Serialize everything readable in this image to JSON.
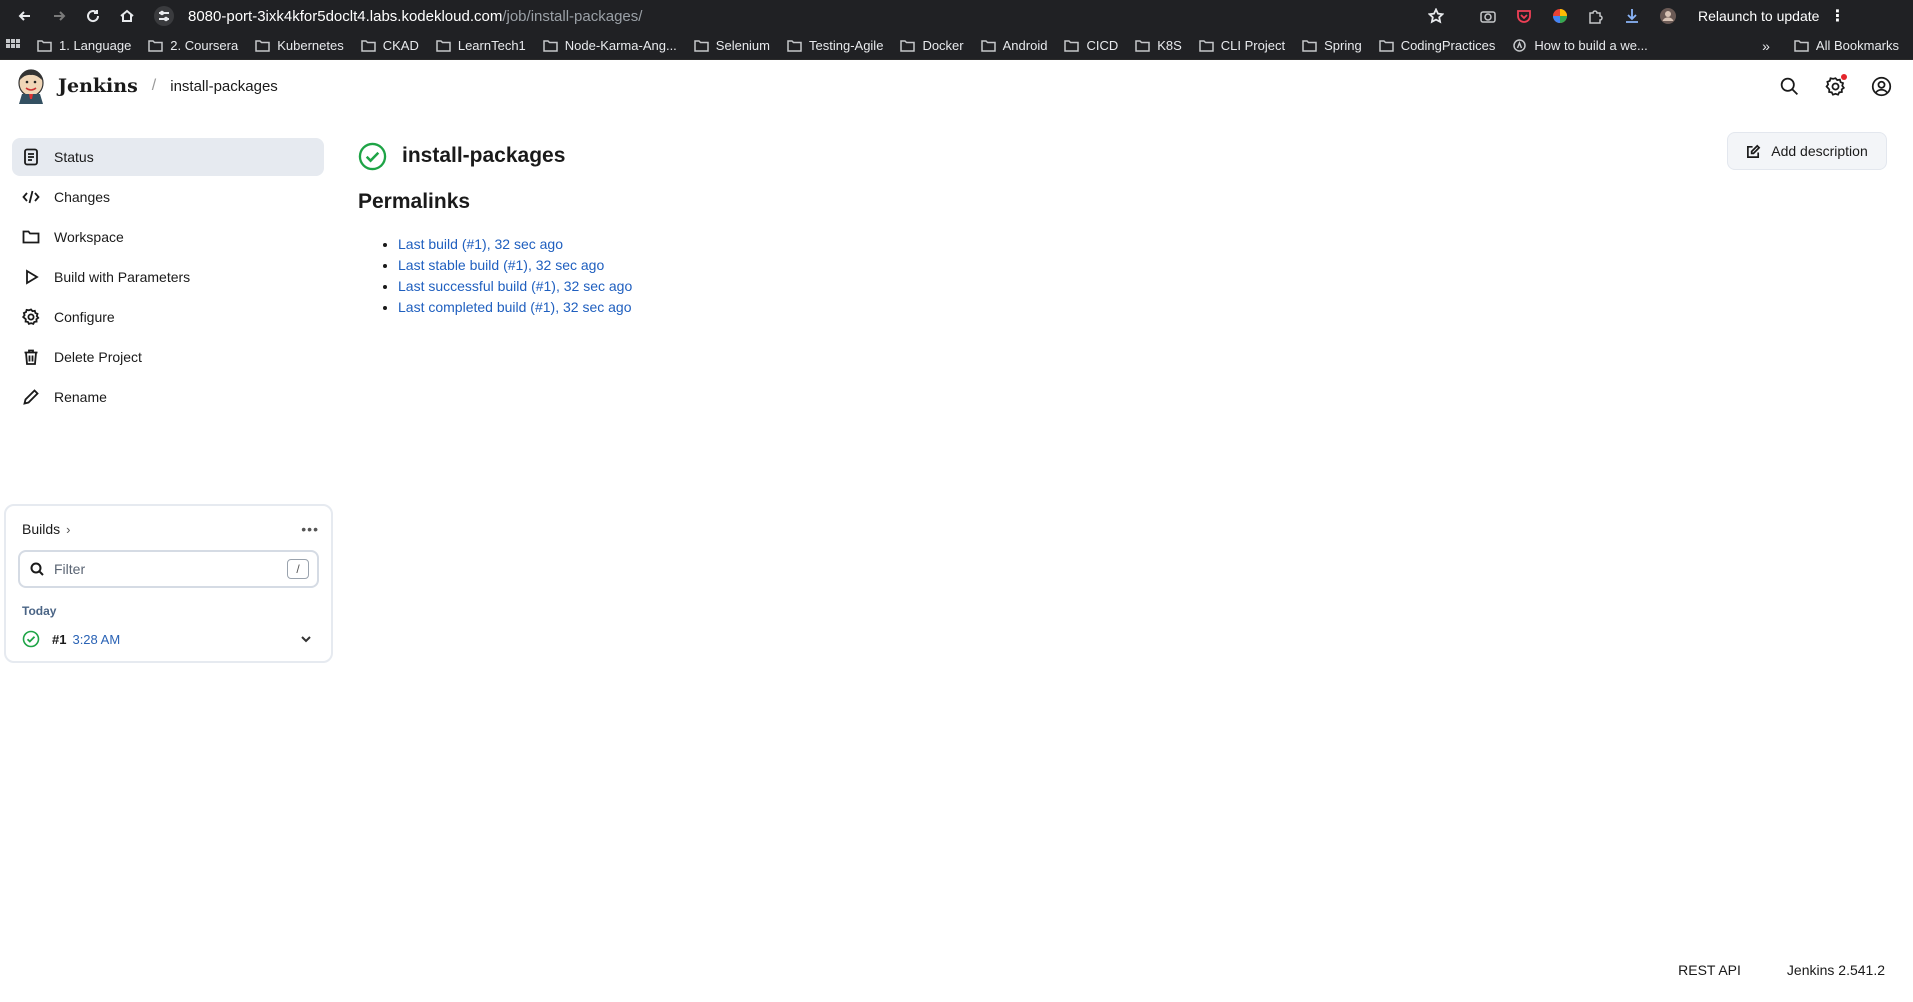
{
  "browser": {
    "url_host": "8080-port-3ixk4kfor5doclt4.labs.kodekloud.com",
    "url_path": "/job/install-packages/",
    "relaunch_label": "Relaunch to update",
    "bookmarks": [
      {
        "label": "1. Language"
      },
      {
        "label": "2. Coursera"
      },
      {
        "label": "Kubernetes"
      },
      {
        "label": "CKAD"
      },
      {
        "label": "LearnTech1"
      },
      {
        "label": "Node-Karma-Ang..."
      },
      {
        "label": "Selenium"
      },
      {
        "label": "Testing-Agile"
      },
      {
        "label": "Docker"
      },
      {
        "label": "Android"
      },
      {
        "label": "CICD"
      },
      {
        "label": "K8S"
      },
      {
        "label": "CLI Project"
      },
      {
        "label": "Spring"
      },
      {
        "label": "CodingPractices"
      },
      {
        "label": "How to build a we..."
      }
    ],
    "more_label": "»",
    "all_bookmarks_label": "All Bookmarks"
  },
  "header": {
    "brand": "Jenkins",
    "separator": "/",
    "breadcrumb": "install-packages"
  },
  "sidebar": {
    "items": [
      {
        "label": "Status",
        "icon": "status-icon",
        "active": true
      },
      {
        "label": "Changes",
        "icon": "code-icon"
      },
      {
        "label": "Workspace",
        "icon": "folder-icon"
      },
      {
        "label": "Build with Parameters",
        "icon": "play-icon"
      },
      {
        "label": "Configure",
        "icon": "gear-icon"
      },
      {
        "label": "Delete Project",
        "icon": "trash-icon"
      },
      {
        "label": "Rename",
        "icon": "pencil-icon"
      }
    ]
  },
  "builds": {
    "title": "Builds",
    "filter_placeholder": "Filter",
    "shortcut": "/",
    "group_label": "Today",
    "items": [
      {
        "number": "#1",
        "time": "3:28 AM",
        "status": "success"
      }
    ]
  },
  "main": {
    "job_title": "install-packages",
    "add_description_label": "Add description",
    "permalinks_title": "Permalinks",
    "permalinks": [
      {
        "label": "Last build (#1), 32 sec ago"
      },
      {
        "label": "Last stable build (#1), 32 sec ago"
      },
      {
        "label": "Last successful build (#1), 32 sec ago"
      },
      {
        "label": "Last completed build (#1), 32 sec ago"
      }
    ]
  },
  "footer": {
    "rest_api": "REST API",
    "version": "Jenkins 2.541.2"
  },
  "colors": {
    "success": "#1ea446",
    "link": "#1f5fbf",
    "active_bg": "#e6eaf0"
  }
}
